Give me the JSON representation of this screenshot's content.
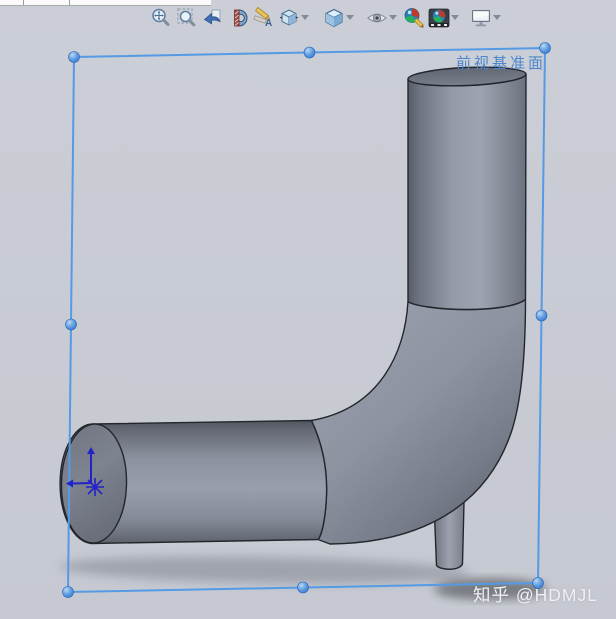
{
  "background": {
    "color": "#c9ccd4"
  },
  "toolbar": {
    "buttons": [
      {
        "name": "zoom-to-fit"
      },
      {
        "name": "zoom-to-area"
      },
      {
        "name": "previous-view"
      },
      {
        "name": "section-view"
      },
      {
        "name": "sketch-annotation"
      },
      {
        "name": "view-orientation",
        "dropdown": true
      },
      {
        "name": "display-style",
        "dropdown": true
      },
      {
        "name": "hide-show-items",
        "dropdown": true
      },
      {
        "name": "edit-appearance",
        "dropdown": false
      },
      {
        "name": "apply-scene",
        "dropdown": true
      },
      {
        "name": "view-settings",
        "dropdown": true
      }
    ]
  },
  "selection": {
    "label": "前视基准面",
    "outline_color": "#549ae4",
    "label_color": "#4e88cc",
    "handle_count": 8
  },
  "model": {
    "name": "90-degree pipe elbow with stub",
    "base_color": "#8e94a1"
  },
  "origin": {
    "color": "#2222c8"
  },
  "watermark": {
    "text": "知乎 @HDMJL",
    "color": "#eef0f3"
  }
}
